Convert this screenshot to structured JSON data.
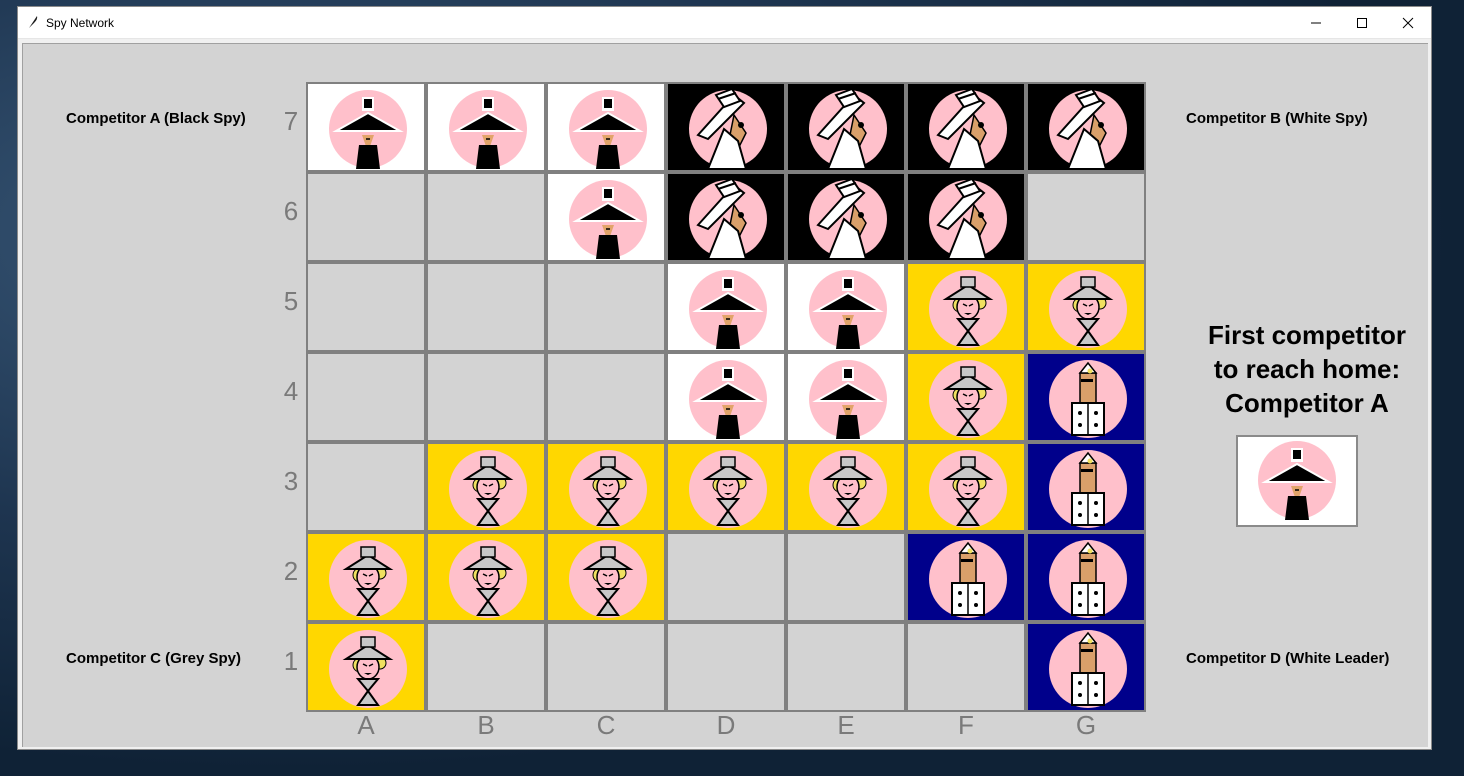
{
  "window": {
    "title": "Spy Network"
  },
  "labels": {
    "competitor_a": "Competitor A (Black Spy)",
    "competitor_b": "Competitor B (White Spy)",
    "competitor_c": "Competitor C (Grey Spy)",
    "competitor_d": "Competitor D (White Leader)"
  },
  "board": {
    "files": [
      "A",
      "B",
      "C",
      "D",
      "E",
      "F",
      "G"
    ],
    "ranks": [
      "7",
      "6",
      "5",
      "4",
      "3",
      "2",
      "1"
    ],
    "cells": [
      [
        {
          "owner": "black-spy"
        },
        {
          "owner": "black-spy"
        },
        {
          "owner": "black-spy"
        },
        {
          "owner": "white-spy"
        },
        {
          "owner": "white-spy"
        },
        {
          "owner": "white-spy"
        },
        {
          "owner": "white-spy"
        }
      ],
      [
        {
          "owner": "empty"
        },
        {
          "owner": "empty"
        },
        {
          "owner": "black-spy"
        },
        {
          "owner": "white-spy"
        },
        {
          "owner": "white-spy"
        },
        {
          "owner": "white-spy"
        },
        {
          "owner": "empty"
        }
      ],
      [
        {
          "owner": "empty"
        },
        {
          "owner": "empty"
        },
        {
          "owner": "empty"
        },
        {
          "owner": "black-spy"
        },
        {
          "owner": "black-spy"
        },
        {
          "owner": "grey-spy"
        },
        {
          "owner": "grey-spy"
        }
      ],
      [
        {
          "owner": "empty"
        },
        {
          "owner": "empty"
        },
        {
          "owner": "empty"
        },
        {
          "owner": "black-spy"
        },
        {
          "owner": "black-spy"
        },
        {
          "owner": "grey-spy"
        },
        {
          "owner": "white-leader"
        }
      ],
      [
        {
          "owner": "empty"
        },
        {
          "owner": "grey-spy"
        },
        {
          "owner": "grey-spy"
        },
        {
          "owner": "grey-spy"
        },
        {
          "owner": "grey-spy"
        },
        {
          "owner": "grey-spy"
        },
        {
          "owner": "white-leader"
        }
      ],
      [
        {
          "owner": "grey-spy"
        },
        {
          "owner": "grey-spy"
        },
        {
          "owner": "grey-spy"
        },
        {
          "owner": "empty"
        },
        {
          "owner": "empty"
        },
        {
          "owner": "white-leader"
        },
        {
          "owner": "white-leader"
        }
      ],
      [
        {
          "owner": "grey-spy"
        },
        {
          "owner": "empty"
        },
        {
          "owner": "empty"
        },
        {
          "owner": "empty"
        },
        {
          "owner": "empty"
        },
        {
          "owner": "empty"
        },
        {
          "owner": "white-leader"
        }
      ]
    ]
  },
  "winner": {
    "line1": "First competitor",
    "line2": "to reach home:",
    "line3": "Competitor A",
    "piece": "black-spy"
  },
  "colors": {
    "black-spy": "#ffffff",
    "white-spy": "#000000",
    "grey-spy": "#ffd700",
    "white-leader": "#00008b",
    "empty": "#d3d3d3",
    "face": "#ffc0cb"
  }
}
